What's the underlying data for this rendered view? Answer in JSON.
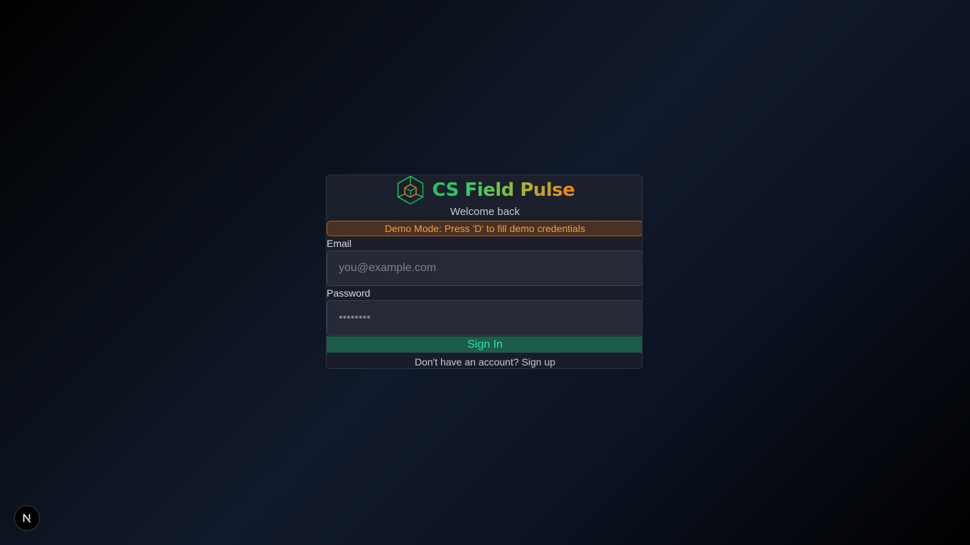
{
  "app": {
    "title": "CS Field Pulse",
    "subtitle": "Welcome back"
  },
  "demo_banner": {
    "text": "Demo Mode: Press 'D' to fill demo credentials"
  },
  "form": {
    "email_label": "Email",
    "email_placeholder": "you@example.com",
    "email_value": "",
    "password_label": "Password",
    "password_placeholder": "••••••••",
    "password_value": "",
    "submit_label": "Sign In"
  },
  "footer": {
    "signup_prompt": "Don't have an account? ",
    "signup_link": "Sign up"
  },
  "icons": {
    "logo": "hexagon-cube-logo-icon",
    "dev_badge": "nextjs-badge-icon"
  },
  "colors": {
    "accent_green": "#22c55e",
    "accent_orange": "#f2811d",
    "signin_bg": "#1d5b4b",
    "signin_text": "#2ee59d",
    "banner_border": "#b8551c",
    "banner_text": "#f59e3b"
  }
}
